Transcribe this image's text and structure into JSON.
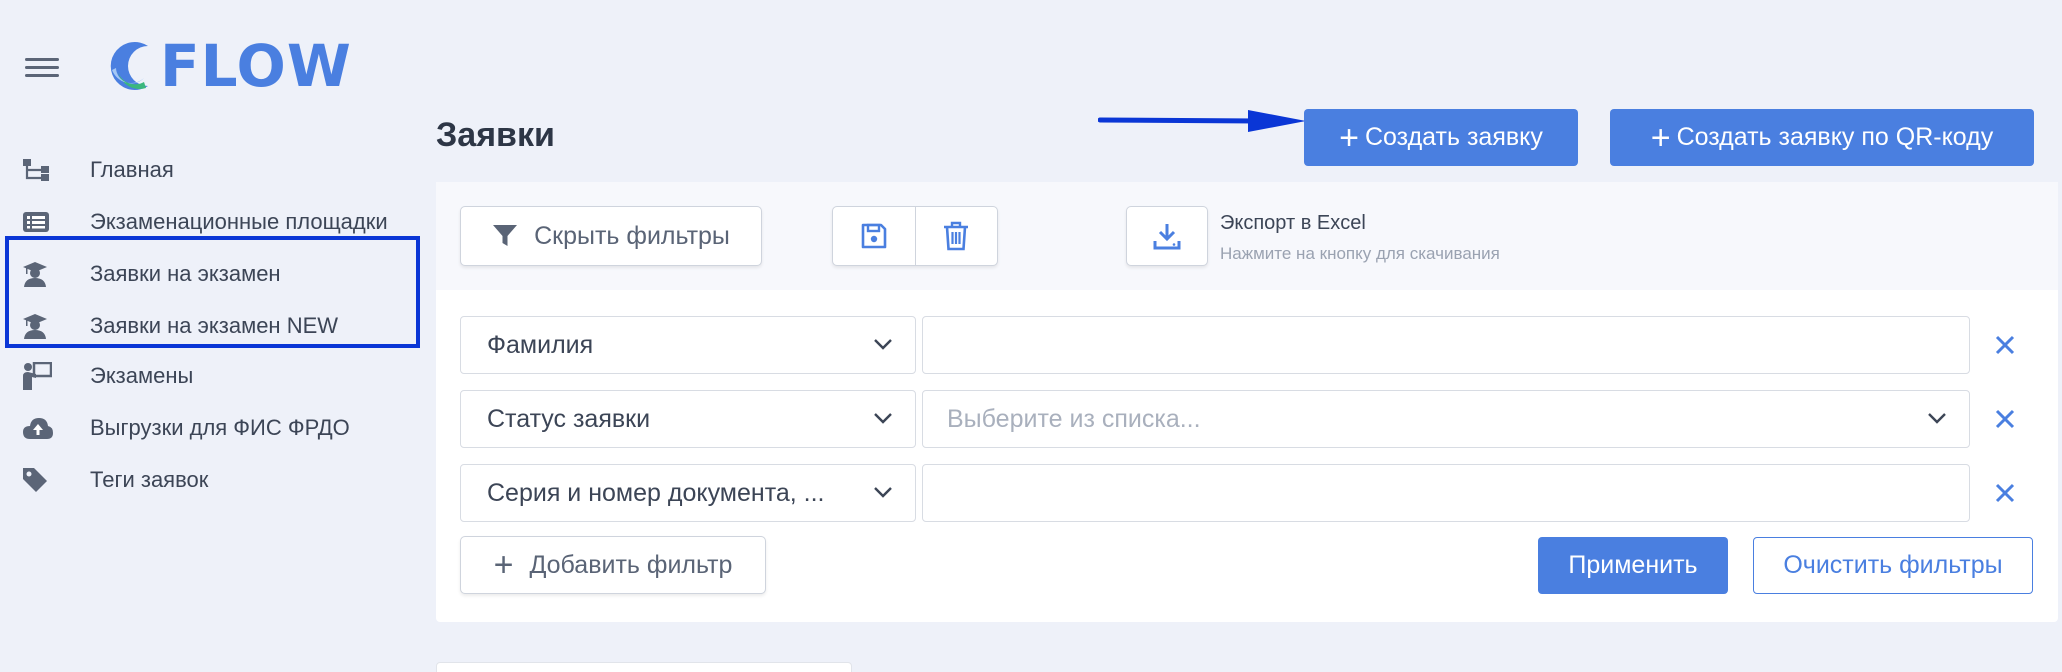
{
  "app": {
    "logo_text": "FLOW"
  },
  "sidebar": {
    "items": [
      {
        "label": "Главная",
        "icon": "sitemap-icon"
      },
      {
        "label": "Экзаменационные площадки",
        "icon": "list-icon"
      },
      {
        "label": "Заявки на экзамен",
        "icon": "graduate-icon"
      },
      {
        "label": "Заявки на экзамен NEW",
        "icon": "graduate-icon"
      },
      {
        "label": "Экзамены",
        "icon": "presenter-icon"
      },
      {
        "label": "Выгрузки для ФИС ФРДО",
        "icon": "cloud-upload-icon"
      },
      {
        "label": "Теги заявок",
        "icon": "tag-icon"
      }
    ]
  },
  "page": {
    "title": "Заявки",
    "create_button": "Создать заявку",
    "create_qr_button": "Создать заявку по QR-коду"
  },
  "toolbar": {
    "hide_filters": "Скрыть фильтры",
    "export_title": "Экспорт в Excel",
    "export_hint": "Нажмите на кнопку для скачивания"
  },
  "filters": [
    {
      "field": "Фамилия",
      "value": "",
      "placeholder": ""
    },
    {
      "field": "Статус заявки",
      "value": "",
      "placeholder": "Выберите из списка..."
    },
    {
      "field": "Серия и номер документа, ...",
      "value": "",
      "placeholder": ""
    }
  ],
  "actions": {
    "add_filter": "Добавить фильтр",
    "apply": "Применить",
    "clear": "Очистить фильтры"
  },
  "colors": {
    "accent": "#4a7fe0",
    "annotation": "#0a36d6",
    "background": "#eef1f9"
  }
}
